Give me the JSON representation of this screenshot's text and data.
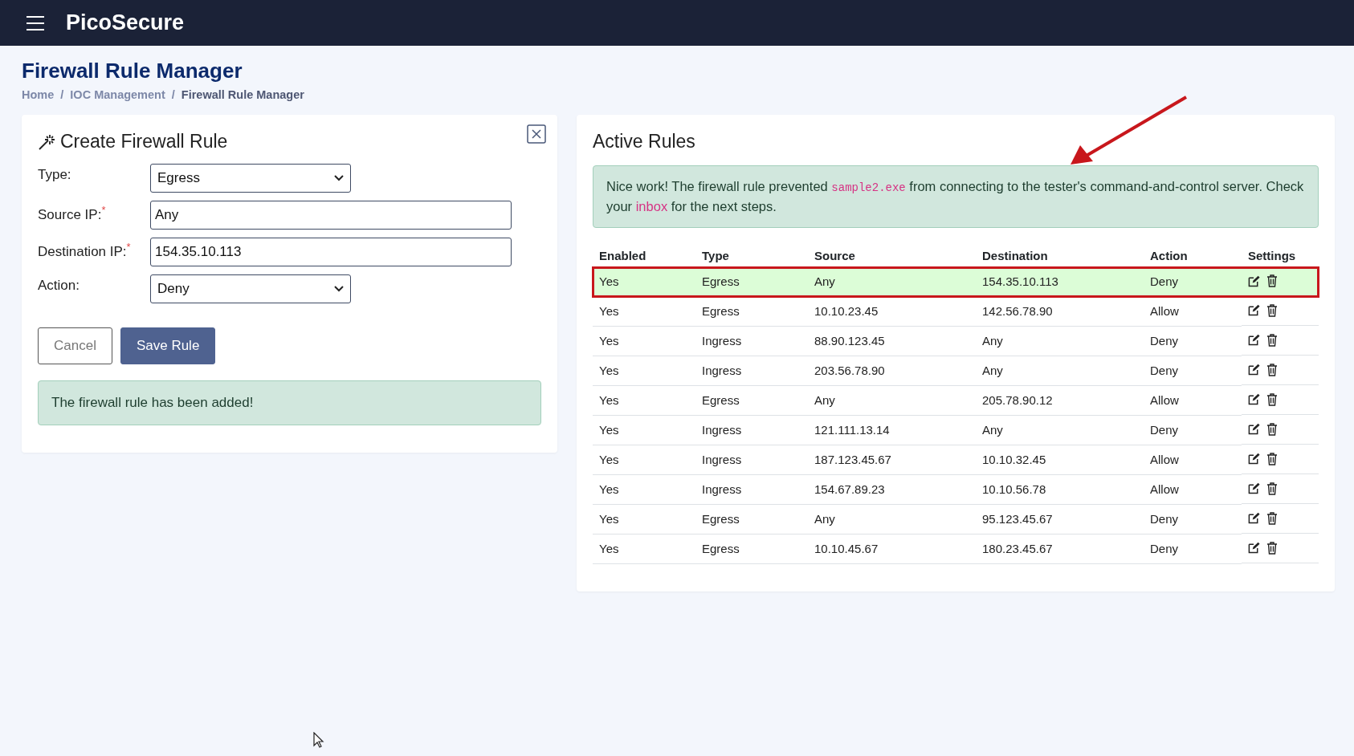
{
  "app": {
    "name": "PicoSecure"
  },
  "page": {
    "title": "Firewall Rule Manager",
    "breadcrumb": [
      {
        "label": "Home",
        "current": false
      },
      {
        "label": "IOC Management",
        "current": false
      },
      {
        "label": "Firewall Rule Manager",
        "current": true
      }
    ],
    "separator": "/"
  },
  "form": {
    "title": "Create Firewall Rule",
    "fields": [
      {
        "kind": "select",
        "label": "Type:",
        "value": "Egress"
      },
      {
        "kind": "input",
        "label": "Source IP:",
        "marker": "*",
        "value": "Any"
      },
      {
        "kind": "input",
        "label": "Destination IP:",
        "marker": "*",
        "value": "154.35.10.113"
      },
      {
        "kind": "select",
        "label": "Action:",
        "value": "Deny"
      }
    ],
    "buttons": [
      {
        "kind": "secondary",
        "label": "Cancel"
      },
      {
        "kind": "primary",
        "label": "Save Rule"
      }
    ],
    "alert": "The firewall rule has been added!"
  },
  "rules": {
    "title": "Active Rules",
    "message": {
      "before": "Nice work! The firewall rule prevented ",
      "code": "sample2.exe",
      "middle": " from connecting to the tester's command-and-control server. Check your ",
      "link": "inbox",
      "after": " for the next steps."
    },
    "columns": [
      "Enabled",
      "Type",
      "Source",
      "Destination",
      "Action",
      "Settings"
    ],
    "rows": [
      {
        "enabled": "Yes",
        "type": "Egress",
        "source": "Any",
        "destination": "154.35.10.113",
        "action": "Deny",
        "highlighted": true
      },
      {
        "enabled": "Yes",
        "type": "Egress",
        "source": "10.10.23.45",
        "destination": "142.56.78.90",
        "action": "Allow",
        "highlighted": false
      },
      {
        "enabled": "Yes",
        "type": "Ingress",
        "source": "88.90.123.45",
        "destination": "Any",
        "action": "Deny",
        "highlighted": false
      },
      {
        "enabled": "Yes",
        "type": "Ingress",
        "source": "203.56.78.90",
        "destination": "Any",
        "action": "Deny",
        "highlighted": false
      },
      {
        "enabled": "Yes",
        "type": "Egress",
        "source": "Any",
        "destination": "205.78.90.12",
        "action": "Allow",
        "highlighted": false
      },
      {
        "enabled": "Yes",
        "type": "Ingress",
        "source": "121.111.13.14",
        "destination": "Any",
        "action": "Deny",
        "highlighted": false
      },
      {
        "enabled": "Yes",
        "type": "Ingress",
        "source": "187.123.45.67",
        "destination": "10.10.32.45",
        "action": "Allow",
        "highlighted": false
      },
      {
        "enabled": "Yes",
        "type": "Ingress",
        "source": "154.67.89.23",
        "destination": "10.10.56.78",
        "action": "Allow",
        "highlighted": false
      },
      {
        "enabled": "Yes",
        "type": "Egress",
        "source": "Any",
        "destination": "95.123.45.67",
        "action": "Deny",
        "highlighted": false
      },
      {
        "enabled": "Yes",
        "type": "Egress",
        "source": "10.10.45.67",
        "destination": "180.23.45.67",
        "action": "Deny",
        "highlighted": false
      }
    ]
  }
}
